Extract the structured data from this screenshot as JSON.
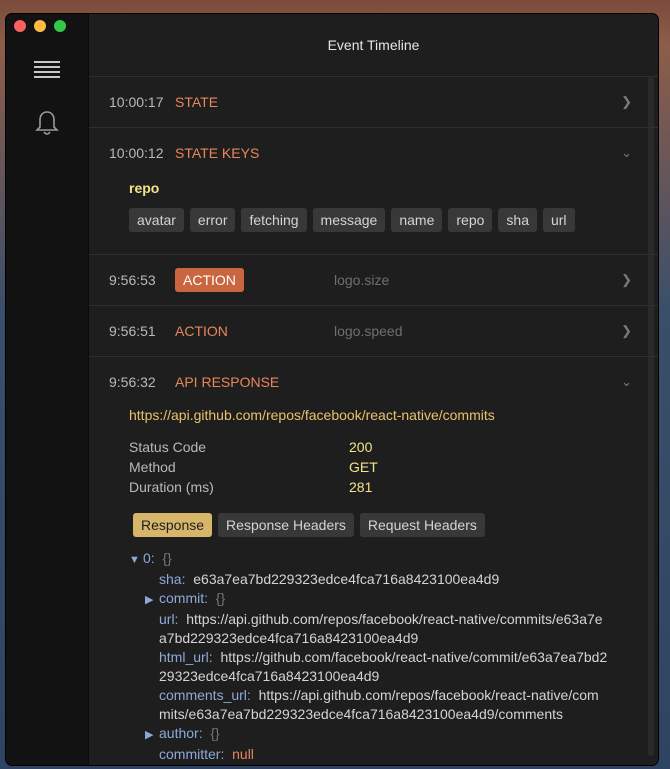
{
  "window": {
    "title": "Event Timeline"
  },
  "sidebar": {
    "icons": [
      "menu-icon",
      "bell-icon"
    ]
  },
  "events": [
    {
      "time": "10:00:17",
      "type": "STATE",
      "subtitle": "",
      "expanded": false
    },
    {
      "time": "10:00:12",
      "type": "STATE KEYS",
      "subtitle": "",
      "expanded": true,
      "keys_title": "repo",
      "keys": [
        "avatar",
        "error",
        "fetching",
        "message",
        "name",
        "repo",
        "sha",
        "url"
      ]
    },
    {
      "time": "9:56:53",
      "type": "ACTION",
      "subtitle": "logo.size",
      "expanded": false,
      "badge": true
    },
    {
      "time": "9:56:51",
      "type": "ACTION",
      "subtitle": "logo.speed",
      "expanded": false
    },
    {
      "time": "9:56:32",
      "type": "API RESPONSE",
      "subtitle": "",
      "expanded": true,
      "url": "https://api.github.com/repos/facebook/react-native/commits",
      "status_code_label": "Status Code",
      "status_code": "200",
      "method_label": "Method",
      "method": "GET",
      "duration_label": "Duration (ms)",
      "duration": "281",
      "tabs": [
        "Response",
        "Response Headers",
        "Request Headers"
      ],
      "active_tab": "Response",
      "tree": {
        "root_key": "0:",
        "root_brace": "{}",
        "sha_key": "sha:",
        "sha": "e63a7ea7bd229323edce4fca716a8423100ea4d9",
        "commit_key": "commit:",
        "commit_brace": "{}",
        "url_key": "url:",
        "url": "https://api.github.com/repos/facebook/react-native/commits/e63a7ea7bd229323edce4fca716a8423100ea4d9",
        "html_url_key": "html_url:",
        "html_url": "https://github.com/facebook/react-native/commit/e63a7ea7bd229323edce4fca716a8423100ea4d9",
        "comments_url_key": "comments_url:",
        "comments_url": "https://api.github.com/repos/facebook/react-native/commits/e63a7ea7bd229323edce4fca716a8423100ea4d9/comments",
        "author_key": "author:",
        "author_brace": "{}",
        "committer_key": "committer:",
        "committer": "null"
      }
    }
  ],
  "colors": {
    "accent": "#e8865a",
    "badge": "#c9653f",
    "key": "#f5e38a",
    "url": "#e8c26d"
  }
}
